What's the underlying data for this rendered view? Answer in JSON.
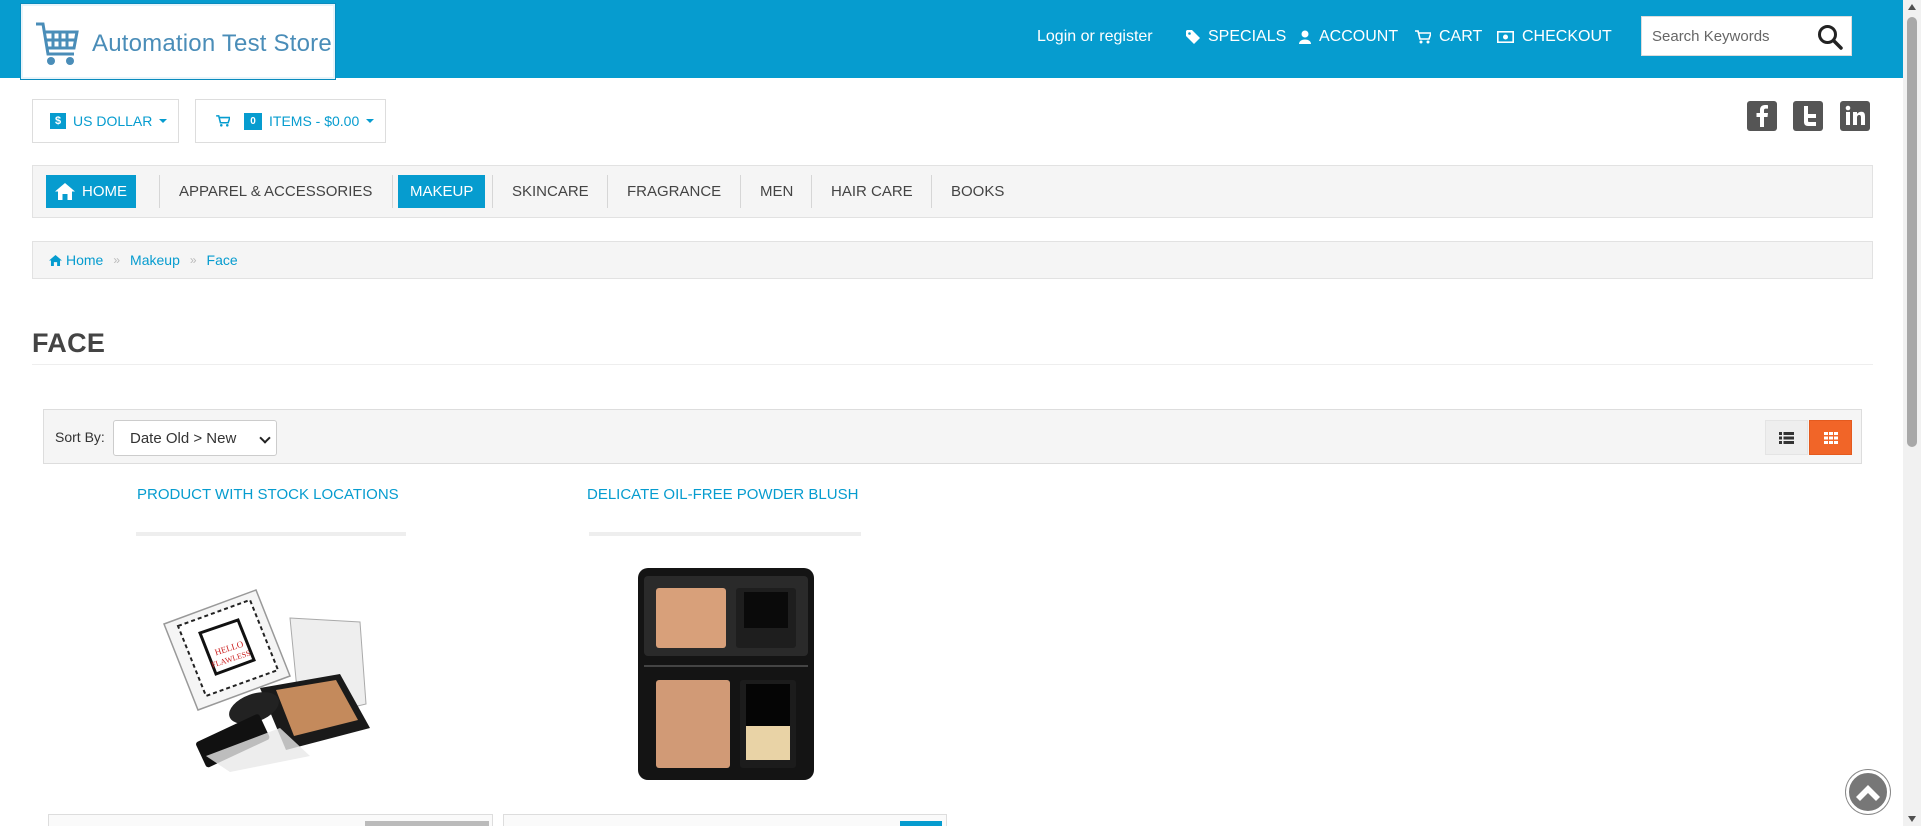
{
  "store": {
    "name": "Automation Test Store"
  },
  "header": {
    "login_label": "Login or register",
    "nav": {
      "specials": "SPECIALS",
      "account": "ACCOUNT",
      "cart": "CART",
      "checkout": "CHECKOUT"
    },
    "search": {
      "placeholder": "Search Keywords",
      "value": ""
    }
  },
  "currency": {
    "symbol": "$",
    "label": "US DOLLAR"
  },
  "cart_summary": {
    "count": "0",
    "label": "ITEMS - $0.00"
  },
  "social": [
    "facebook-icon",
    "twitter-icon",
    "linkedin-icon"
  ],
  "menu": {
    "home": "HOME",
    "items": [
      "APPAREL & ACCESSORIES",
      "MAKEUP",
      "SKINCARE",
      "FRAGRANCE",
      "MEN",
      "HAIR CARE",
      "BOOKS"
    ],
    "active": "MAKEUP"
  },
  "breadcrumb": {
    "home": "Home",
    "level1": "Makeup",
    "level2": "Face"
  },
  "page": {
    "title": "FACE"
  },
  "sort": {
    "label": "Sort By:",
    "selected": "Date Old > New"
  },
  "products": [
    {
      "title": "PRODUCT WITH STOCK LOCATIONS"
    },
    {
      "title": "DELICATE OIL-FREE POWDER BLUSH"
    }
  ],
  "colors": {
    "brand": "#069ccf",
    "accent": "#f16528"
  }
}
